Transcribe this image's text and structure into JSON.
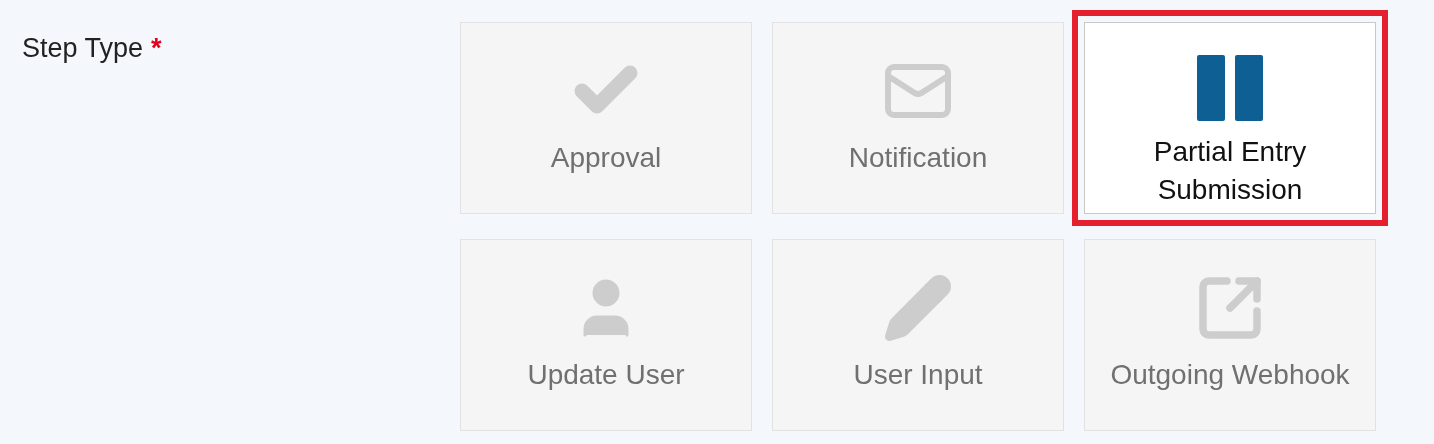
{
  "field": {
    "label": "Step Type",
    "required_mark": "*"
  },
  "step_types": [
    {
      "label": "Approval",
      "kind": "check",
      "selected": false
    },
    {
      "label": "Notification",
      "kind": "mail",
      "selected": false
    },
    {
      "label": "Partial Entry Submission",
      "kind": "pause",
      "selected": true
    },
    {
      "label": "Update User",
      "kind": "user",
      "selected": false
    },
    {
      "label": "User Input",
      "kind": "pencil",
      "selected": false
    },
    {
      "label": "Outgoing Webhook",
      "kind": "share",
      "selected": false
    }
  ]
}
